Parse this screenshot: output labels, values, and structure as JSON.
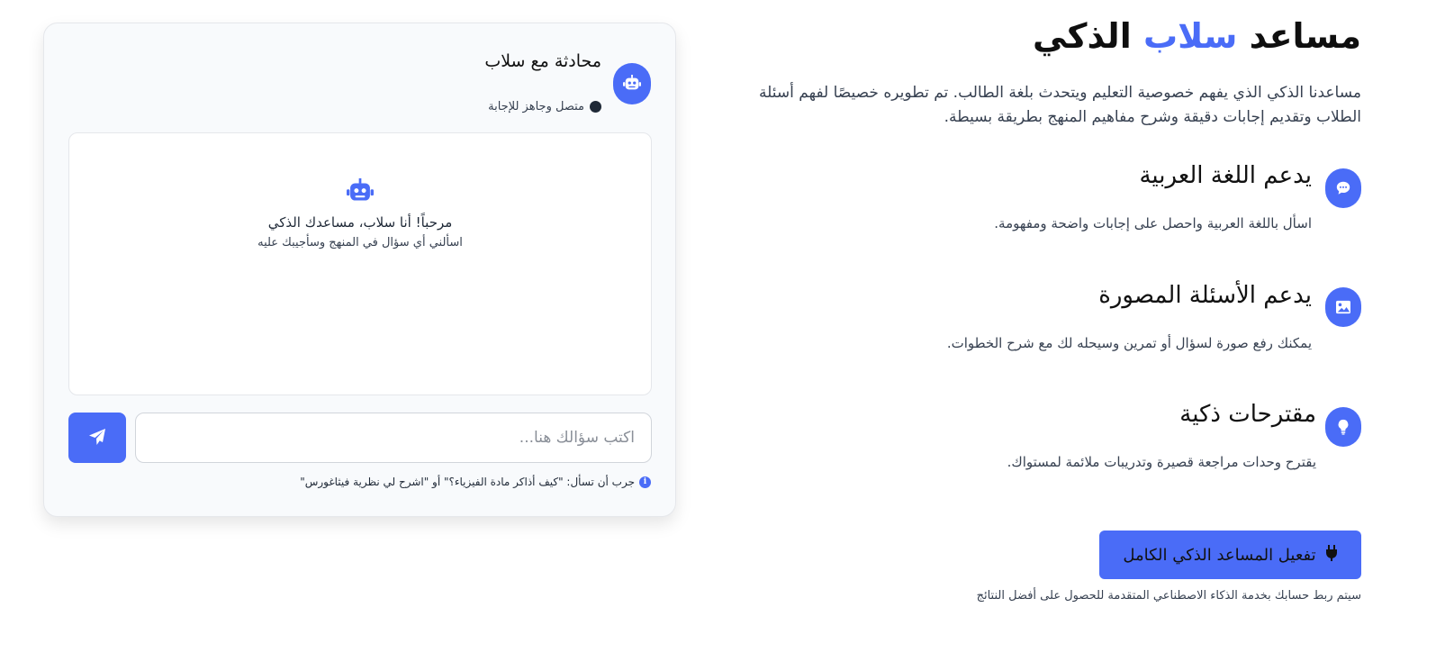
{
  "hero": {
    "title_part1": "مساعد",
    "title_accent": "سلاب",
    "title_part2": "الذكي",
    "intro": "مساعدنا الذكي الذي يفهم خصوصية التعليم ويتحدث بلغة الطالب. تم تطويره خصيصًا لفهم أسئلة الطلاب وتقديم إجابات دقيقة وشرح مفاهيم المنهج بطريقة بسيطة."
  },
  "features": [
    {
      "icon": "chat-bubble-icon",
      "title": "يدعم اللغة العربية",
      "desc": "اسأل باللغة العربية واحصل على إجابات واضحة ومفهومة."
    },
    {
      "icon": "image-icon",
      "title": "يدعم الأسئلة المصورة",
      "desc": "يمكنك رفع صورة لسؤال أو تمرين وسيحله لك مع شرح الخطوات."
    },
    {
      "icon": "lightbulb-icon",
      "title": "مقترحات ذكية",
      "desc": "يقترح وحدات مراجعة قصيرة وتدريبات ملائمة لمستواك."
    }
  ],
  "cta": {
    "label": "تفعيل المساعد الذكي الكامل",
    "note": "سيتم ربط حسابك بخدمة الذكاء الاصطناعي المتقدمة للحصول على أفضل النتائج"
  },
  "chat": {
    "title": "محادثة مع سلاب",
    "status": "متصل وجاهز للإجابة",
    "welcome_line1": "مرحباً! أنا سلاب، مساعدك الذكي",
    "welcome_line2": "اسألني أي سؤال في المنهج وسأجيبك عليه",
    "input_placeholder": "اكتب سؤالك هنا...",
    "input_value": "",
    "hint": "جرب أن تسأل: \"كيف أذاكر مادة الفيزياء؟\" أو \"اشرح لي نظرية فيثاغورس\""
  },
  "colors": {
    "accent": "#4a6cf7",
    "status_dot": "#1f2937"
  }
}
